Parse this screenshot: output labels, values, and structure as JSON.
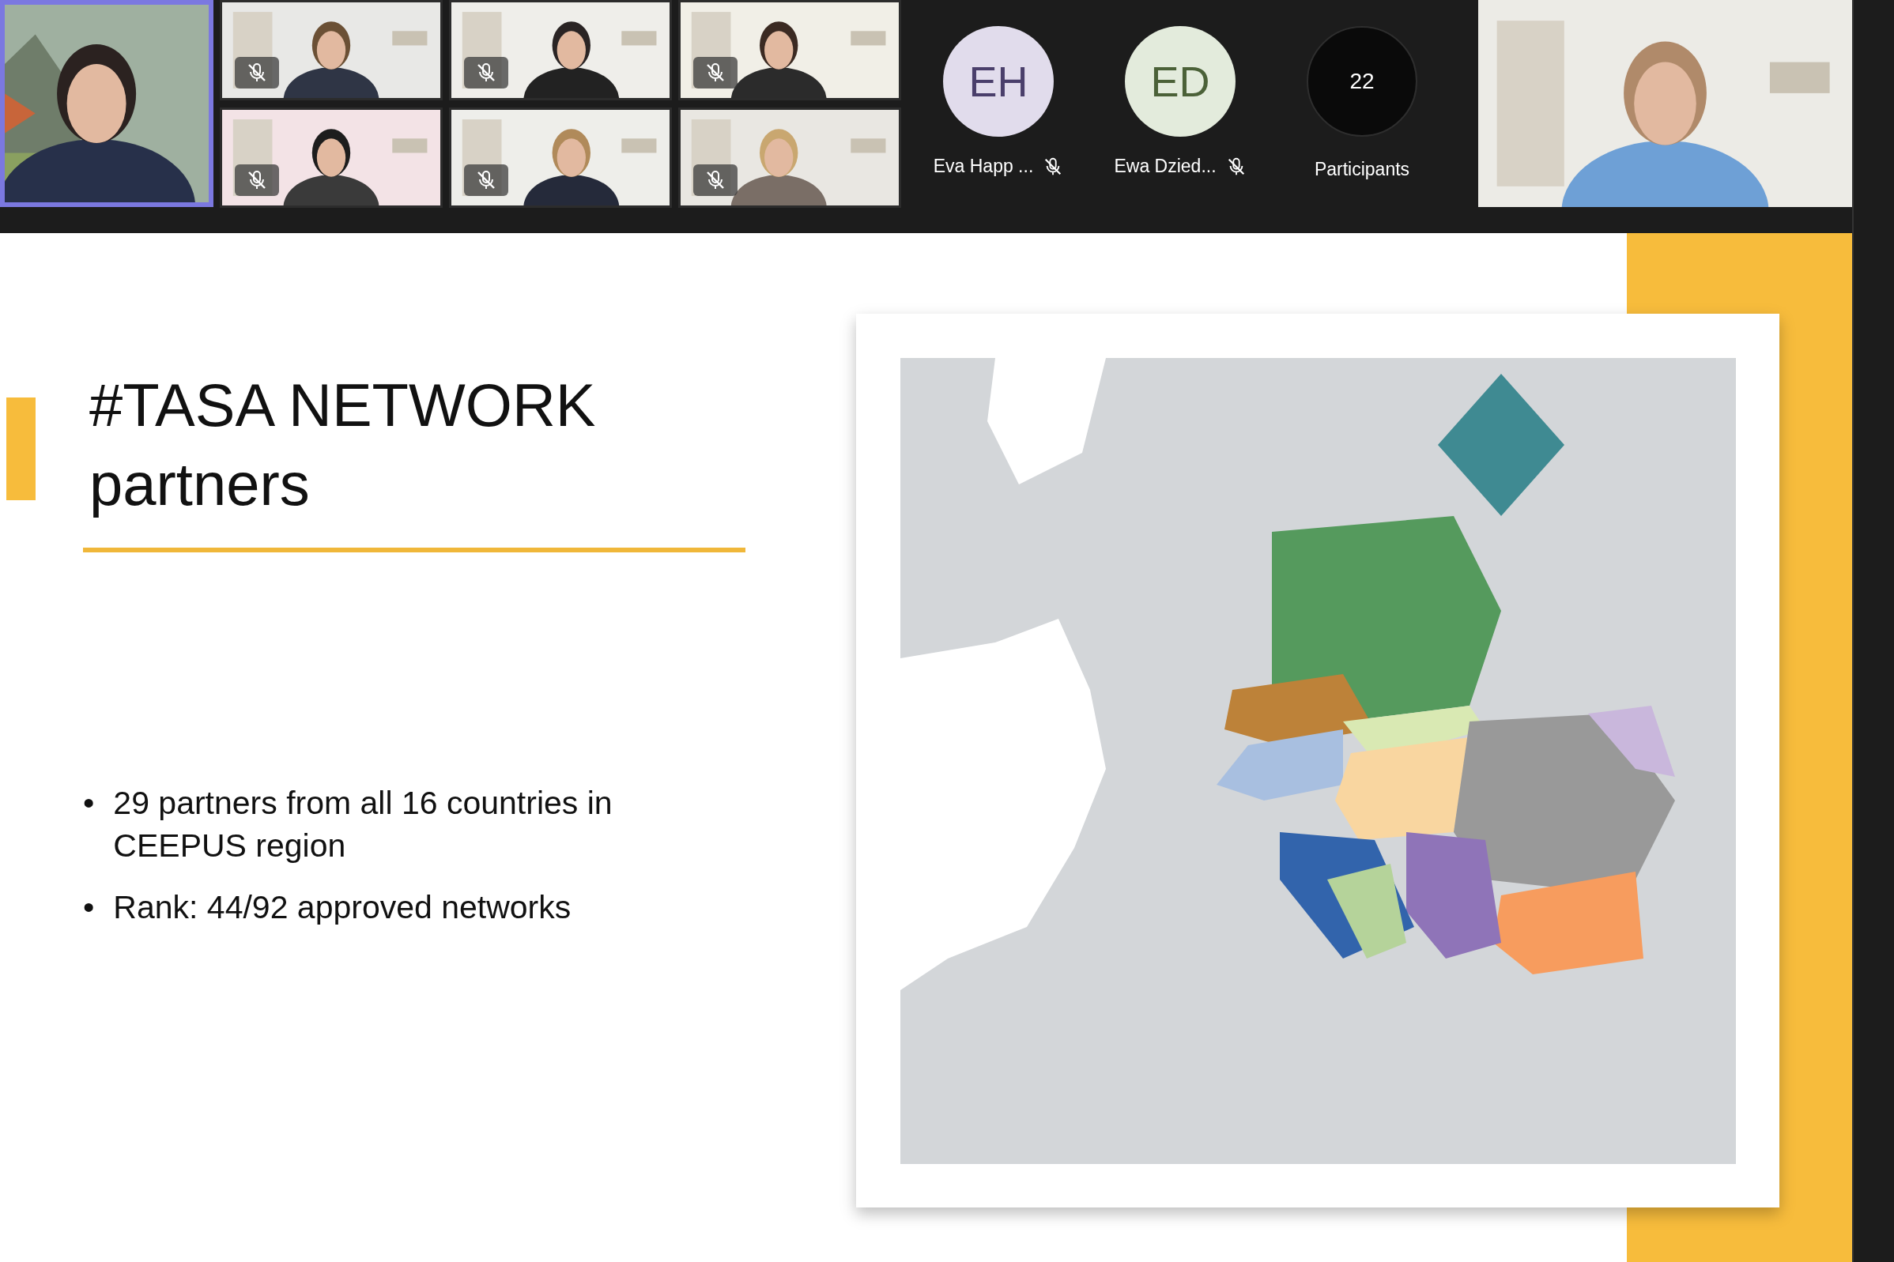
{
  "video_tiles": [
    {
      "selected": true,
      "muted": false
    },
    {
      "selected": false,
      "muted": true
    },
    {
      "selected": false,
      "muted": true
    },
    {
      "selected": false,
      "muted": true
    },
    {
      "selected": false,
      "muted": true
    },
    {
      "selected": false,
      "muted": true
    },
    {
      "selected": false,
      "muted": true
    }
  ],
  "avatars": [
    {
      "initials": "EH",
      "name": "Eva Happ ...",
      "muted": true,
      "color": "#e1dcec"
    },
    {
      "initials": "ED",
      "name": "Ewa Dzied...",
      "muted": true,
      "color": "#e3ebdc"
    }
  ],
  "participants": {
    "count": "22",
    "label": "Participants"
  },
  "slide": {
    "title": "#TASA NETWORK partners",
    "bullets": [
      {
        "marker": "•",
        "text": "29 partners from all 16 countries in CEEPUS region"
      },
      {
        "marker": "•",
        "text": "Rank: 44/92 approved networks"
      }
    ]
  }
}
